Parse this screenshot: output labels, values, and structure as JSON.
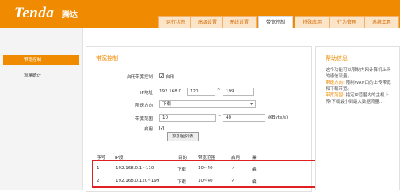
{
  "brand": {
    "logo_text": "Tenda",
    "logo_cn": "腾达",
    "accent": "#f08a00"
  },
  "tabs": [
    {
      "label": "运行状态"
    },
    {
      "label": "高级设置"
    },
    {
      "label": "无线设置"
    },
    {
      "label": "带宽控制"
    },
    {
      "label": "特殊应用"
    },
    {
      "label": "行为管理"
    },
    {
      "label": "系统工具"
    }
  ],
  "active_tab": "带宽控制",
  "sidebar": {
    "items": [
      {
        "label": "带宽控制"
      },
      {
        "label": "流量统计"
      }
    ]
  },
  "main": {
    "title": "带宽控制",
    "enable_label": "启用带宽控制",
    "enable_text": "启用",
    "enable_checked": true,
    "ip_label": "IP地址",
    "ip_prefix": "192.168.0.",
    "ip_start": "120",
    "ip_sep": "~",
    "ip_end": "199",
    "direction_label": "限速方向",
    "direction_value": "下载",
    "bandwidth_label": "带宽范围",
    "bw_min": "10",
    "bw_sep": "~",
    "bw_max": "40",
    "bw_unit": "(KByte/s)",
    "rule_enable_label": "启用",
    "rule_enable_checked": true,
    "add_button": "添加至列表",
    "table": {
      "headers": [
        "序号",
        "IP段",
        "目的",
        "带宽范围",
        "启用",
        "操"
      ],
      "rows": [
        {
          "no": "1",
          "ip": "192.168.0.1~110",
          "dir": "下载",
          "range": "10~40",
          "enabled": "✓",
          "op": "编"
        },
        {
          "no": "2",
          "ip": "192.168.0.120~199",
          "dir": "下载",
          "range": "10~40",
          "enabled": "✓",
          "op": "编"
        }
      ]
    }
  },
  "help": {
    "title": "帮助信息",
    "line1": "这个功能可以限制内网计算机上网的通信流量。",
    "dir_label": "带速方向:",
    "dir_text": "限制WAN口的上传带宽和下载带宽。",
    "range_label": "带宽范围:",
    "range_text": "指定IP范围内的主机上传/下载最小到最大数据流量..."
  }
}
